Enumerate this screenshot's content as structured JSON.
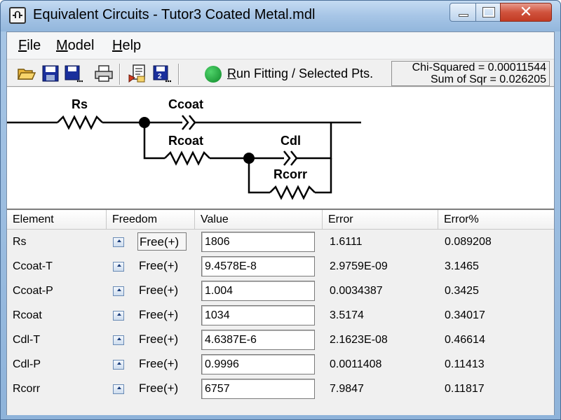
{
  "window": {
    "title": "Equivalent Circuits - Tutor3 Coated Metal.mdl",
    "close_glyph": "✕"
  },
  "menu": [
    {
      "accel": "F",
      "rest": "ile"
    },
    {
      "accel": "M",
      "rest": "odel"
    },
    {
      "accel": "H",
      "rest": "elp"
    }
  ],
  "toolbar": {
    "icons": [
      "folder-open-icon",
      "save-icon",
      "save-as-icon",
      "print-icon",
      "import-icon",
      "export-icon"
    ],
    "run_accel": "R",
    "run_rest": "un Fitting / Selected Pts.",
    "chi_squared": "Chi-Squared = 0.00011544",
    "sum_of_sqr": "Sum of Sqr = 0.026205"
  },
  "circuit": {
    "labels": [
      "Rs",
      "Ccoat",
      "Rcoat",
      "Cdl",
      "Rcorr"
    ]
  },
  "table": {
    "headers": [
      "Element",
      "Freedom",
      "Value",
      "Error",
      "Error%"
    ],
    "rows": [
      {
        "element": "Rs",
        "freedom": "Free(+)",
        "value": "1806",
        "error": "1.6111",
        "error_pct": "0.089208"
      },
      {
        "element": "Ccoat-T",
        "freedom": "Free(+)",
        "value": "9.4578E-8",
        "error": "2.9759E-09",
        "error_pct": "3.1465"
      },
      {
        "element": "Ccoat-P",
        "freedom": "Free(+)",
        "value": "1.004",
        "error": "0.0034387",
        "error_pct": "0.3425"
      },
      {
        "element": "Rcoat",
        "freedom": "Free(+)",
        "value": "1034",
        "error": "3.5174",
        "error_pct": "0.34017"
      },
      {
        "element": "Cdl-T",
        "freedom": "Free(+)",
        "value": "4.6387E-6",
        "error": "2.1623E-08",
        "error_pct": "0.46614"
      },
      {
        "element": "Cdl-P",
        "freedom": "Free(+)",
        "value": "0.9996",
        "error": "0.0011408",
        "error_pct": "0.11413"
      },
      {
        "element": "Rcorr",
        "freedom": "Free(+)",
        "value": "6757",
        "error": "7.9847",
        "error_pct": "0.11817"
      }
    ]
  }
}
